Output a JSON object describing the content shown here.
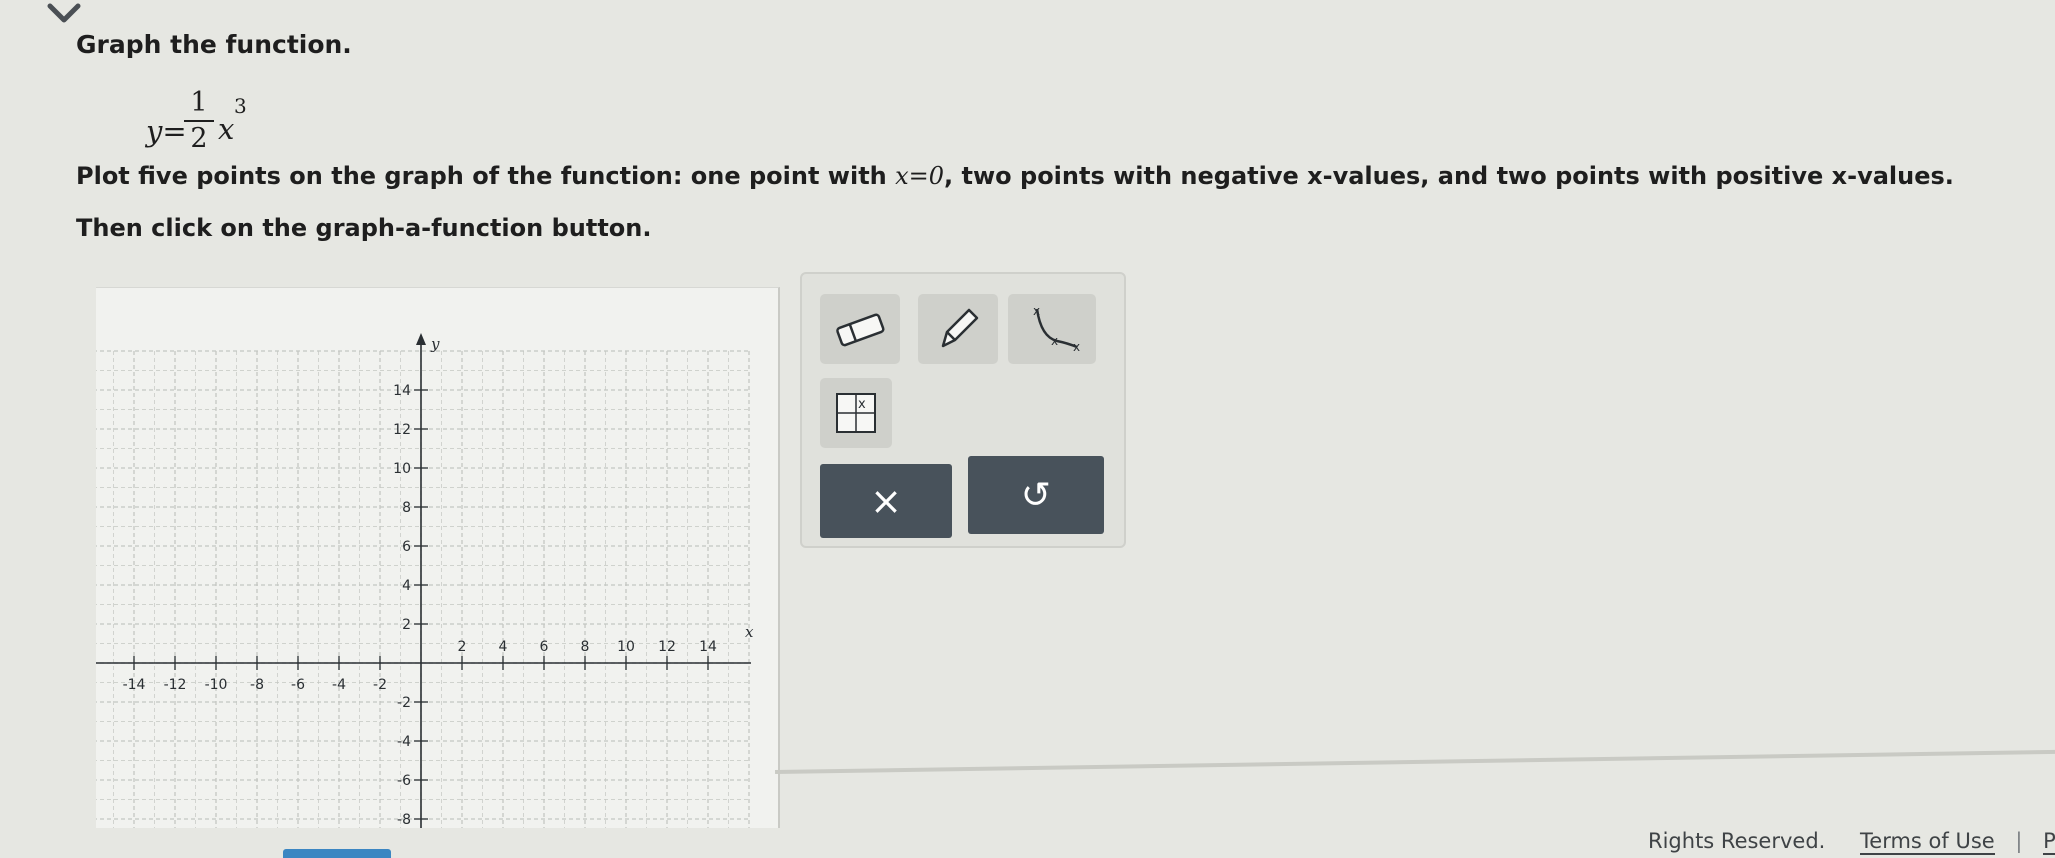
{
  "problem": {
    "title": "Graph the function.",
    "equation": {
      "lhs": "y=",
      "numerator": "1",
      "denominator": "2",
      "variable": "x",
      "exponent": "3"
    },
    "instructions": {
      "part1": "Plot five points on the graph of the function: one point with ",
      "math": "x=0",
      "part2": ", two points with negative x-values, and two points with positive x-values. Then click on the graph-a-function button."
    }
  },
  "graph": {
    "x_axis_label": "x",
    "y_axis_label": "y",
    "x_ticks": [
      "-14",
      "-12",
      "-10",
      "-8",
      "-6",
      "-4",
      "-2",
      "2",
      "4",
      "6",
      "8",
      "10",
      "12",
      "14"
    ],
    "y_ticks": [
      "14",
      "12",
      "10",
      "8",
      "6",
      "4",
      "2",
      "-2",
      "-4",
      "-6",
      "-8"
    ],
    "x_range": [
      -16,
      16
    ],
    "y_range": [
      -10,
      16
    ],
    "grid": true
  },
  "toolbox": {
    "tools": [
      "eraser-icon",
      "pencil-icon",
      "graph-function-icon",
      "plot-point-icon"
    ],
    "clear_label": "×",
    "undo_label": "↺"
  },
  "footer": {
    "rights_text": "Rights Reserved.",
    "terms_label": "Terms of Use",
    "separator": "|",
    "privacy_label": "Privacy"
  }
}
